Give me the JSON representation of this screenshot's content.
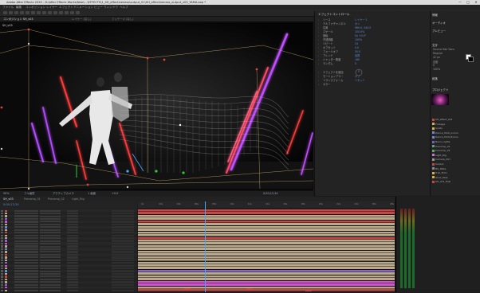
{
  "window": {
    "title": "Adobe After Effects 2020 - D:\\After Effects Works\\New\\...\\EFFECTS\\1_SH_effectiveness\\output_01\\SH_effectiveness_output_v03_YAMA.aep *",
    "controls": [
      "—",
      "□",
      "✕"
    ]
  },
  "menu": [
    "ファイル",
    "編集",
    "コンポジション",
    "レイヤー",
    "エフェクト",
    "アニメーション",
    "ビュー",
    "ウィンドウ",
    "ヘルプ"
  ],
  "toolbar": {
    "workspaces": [
      "デフォルト",
      "標準",
      "小画面",
      "ライブラリ"
    ],
    "search_placeholder": "ヘルプを検索"
  },
  "viewport": {
    "tabs": [
      "コンポジション SH_v03",
      "レイヤー (なし)",
      "フッテージ (なし)"
    ],
    "comp_label": "SH_v03",
    "footer": [
      "50%",
      "フル画質",
      "アクティブカメラ",
      "1 画面",
      "+0.0",
      "0;00;12;24"
    ]
  },
  "effects": {
    "title": "エフェクトコントロール",
    "rows": [
      {
        "name": "ソース",
        "value": "レイヤー 1"
      },
      {
        "name": "アルファチャンネル",
        "value": "オン"
      },
      {
        "name": "位置",
        "value": "960.0, 540.0"
      },
      {
        "name": "スケール",
        "value": "100.0%"
      },
      {
        "name": "回転",
        "value": "0x +0.0°"
      },
      {
        "name": "不透明度",
        "value": "100%"
      },
      {
        "name": "リピート",
        "value": "24"
      },
      {
        "name": "オフセット",
        "value": "0.0"
      },
      {
        "name": "フォールオフ",
        "value": "50.0"
      },
      {
        "name": "ブレンド",
        "value": "加算"
      },
      {
        "name": "シャッター角度",
        "value": "180"
      },
      {
        "name": "ランダム",
        "value": "0"
      }
    ],
    "subsection": [
      {
        "name": "エフェクトを追加",
        "value": ""
      },
      {
        "name": "モーションブラー",
        "value": "オフ"
      },
      {
        "name": "トランスフォーム",
        "value": "リセット"
      },
      {
        "name": "カラー",
        "value": ""
      }
    ]
  },
  "right_panel": {
    "info_title": "情報",
    "audio_title": "オーディオ",
    "preview_title": "プレビュー",
    "char_title": "文字",
    "char_lines": [
      "Source Han Sans",
      "Regular",
      "42 px",
      "自動",
      "0",
      "100%"
    ],
    "para_title": "段落",
    "project_title": "プロジェクト",
    "project_items": [
      {
        "name": "SH_effect_v03",
        "color": "#c44"
      },
      {
        "name": "Footage",
        "color": "#d8b04a"
      },
      {
        "name": "Solids",
        "color": "#d8b04a"
      },
      {
        "name": "Dance_Shot_A.mov",
        "color": "#6a8ccf"
      },
      {
        "name": "Dance_Shot_B.mov",
        "color": "#6a8ccf"
      },
      {
        "name": "Neon_Lights",
        "color": "#7a5cc4"
      },
      {
        "name": "Precomp_01",
        "color": "#5aa86b"
      },
      {
        "name": "Precomp_02",
        "color": "#5aa86b"
      },
      {
        "name": "Light_Rig",
        "color": "#b97ad6"
      },
      {
        "name": "Camera_Ctrl",
        "color": "#999"
      },
      {
        "name": "Output",
        "color": "#c44"
      },
      {
        "name": "BG_Plate",
        "color": "#888"
      },
      {
        "name": "Trail_Echo",
        "color": "#d8b04a"
      },
      {
        "name": "Glow_Pass",
        "color": "#d8b04a"
      },
      {
        "name": "SH_v03_final",
        "color": "#c44"
      }
    ]
  },
  "timeline": {
    "tabs": [
      "SH_v03",
      "Precomp_01",
      "Precomp_02",
      "Light_Rig"
    ],
    "timecode": "0;00;12;24",
    "ruler": [
      "0s",
      "02s",
      "04s",
      "06s",
      "08s",
      "10s",
      "12s",
      "14s",
      "16s",
      "18s",
      "20s",
      "22s",
      "24s",
      "26s",
      "28s"
    ],
    "layer_count": 30,
    "current_time_fraction": 0.26
  },
  "colors": {
    "neon_purple": "#b24cff",
    "neon_red": "#ff3a3a",
    "bar_beige": "#bba98c",
    "bar_red": "#c94646",
    "bar_pink": "#d54fd1",
    "bar_purple": "#8b66c9",
    "cti_blue": "#4aa3ff"
  }
}
